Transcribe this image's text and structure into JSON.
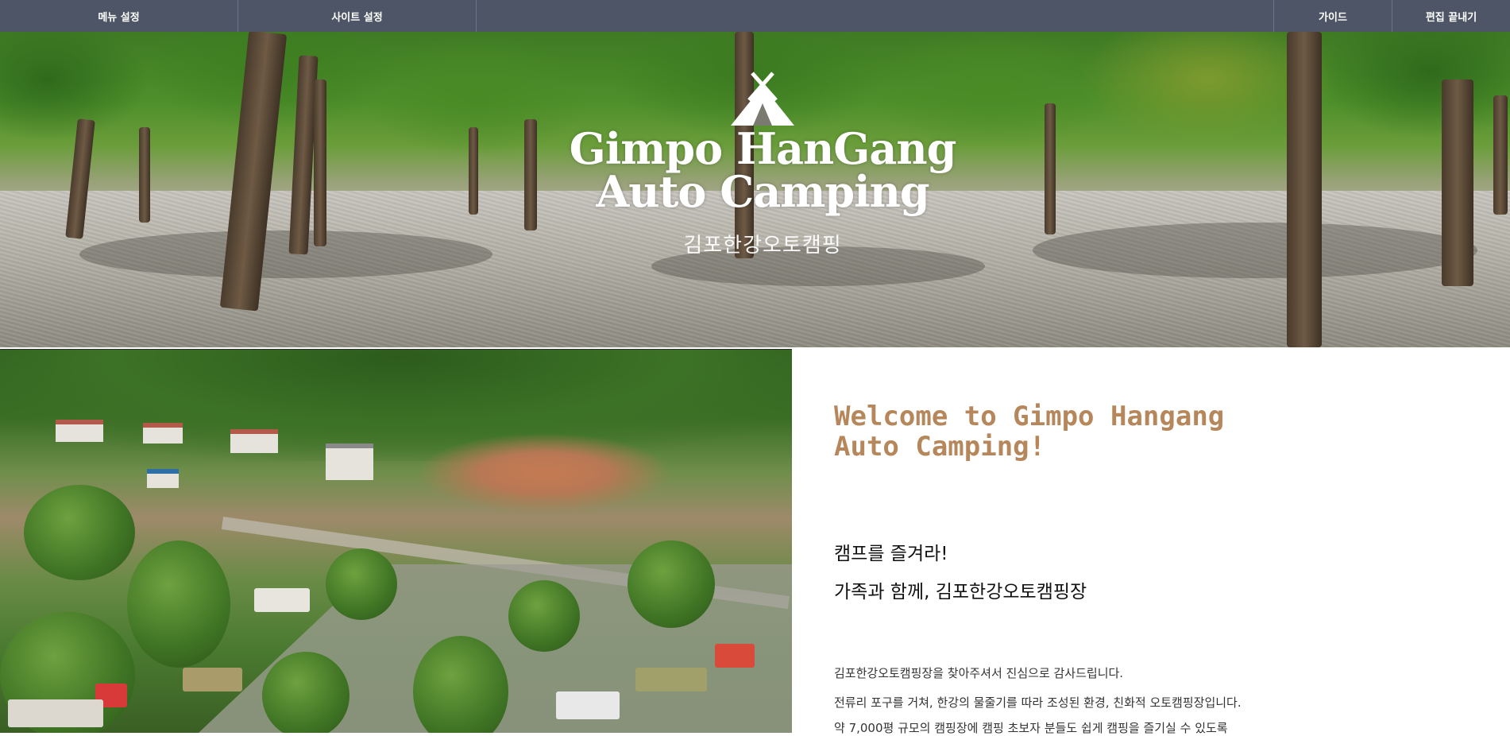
{
  "topbar": {
    "menu_settings": "메뉴 설정",
    "site_settings": "사이트 설정",
    "guide": "가이드",
    "end_edit": "편집 끝내기"
  },
  "hero": {
    "logo_line1": "Gimpo HanGang",
    "logo_line2": "Auto Camping",
    "logo_korean": "김포한강오토캠핑",
    "tent_icon": "tent-icon"
  },
  "content": {
    "welcome": "Welcome to Gimpo Hangang Auto Camping!",
    "subtitle1": "캠프를 즐겨라!",
    "subtitle2": "가족과 함께, 김포한강오토캠핑장",
    "paragraphs": [
      "김포한강오토캠핑장을 찾아주셔서 진심으로 감사드립니다.",
      "전류리 포구를 거쳐, 한강의 물줄기를 따라 조성된 환경, 친화적 오토캠핑장입니다.",
      "약 7,000평 규모의 캠핑장에 캠핑 초보자 분들도 쉽게 캠핑을 즐기실 수 있도록"
    ]
  },
  "colors": {
    "topbar_bg": "#4d5566",
    "welcome_text": "#b7875c"
  }
}
